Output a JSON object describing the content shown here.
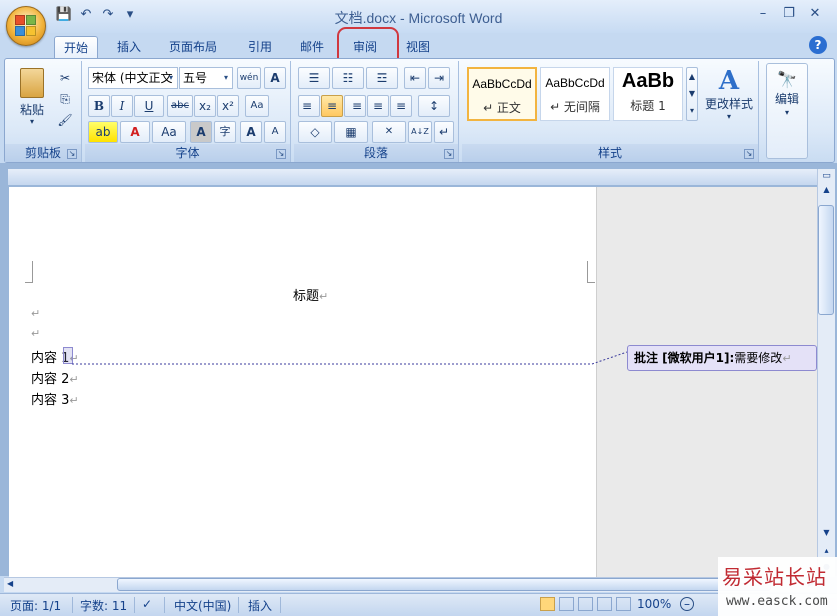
{
  "window": {
    "title": "文档.docx - Microsoft Word"
  },
  "qat": {
    "save": "💾",
    "undo": "↶",
    "redo": "↷",
    "customize": "▾"
  },
  "controls": {
    "minimize": "–",
    "restore": "❐",
    "close": "✕"
  },
  "tabs": [
    {
      "label": "开始",
      "active": true
    },
    {
      "label": "插入"
    },
    {
      "label": "页面布局"
    },
    {
      "label": "引用"
    },
    {
      "label": "邮件"
    },
    {
      "label": "审阅",
      "highlighted": true
    },
    {
      "label": "视图"
    }
  ],
  "help": "?",
  "ribbon": {
    "clipboard": {
      "label": "剪贴板",
      "paste": "粘贴",
      "cut": "✂",
      "copy": "⎘",
      "format_painter": "🖌"
    },
    "font": {
      "label": "字体",
      "font_name": "宋体 (中文正文",
      "font_size": "五号",
      "phonetic": "wén",
      "char_border": "A",
      "bold": "B",
      "italic": "I",
      "underline": "U",
      "strike": "abc",
      "subscript": "x₂",
      "superscript": "x²",
      "clear": "Aa",
      "highlight": "ab",
      "font_color": "A",
      "change_case": "Aa",
      "char_shading": "A",
      "enclose": "字",
      "grow": "A",
      "shrink": "A"
    },
    "paragraph": {
      "label": "段落",
      "bullets": "☰",
      "numbering": "☷",
      "multilevel": "☲",
      "decrease_indent": "⇤",
      "increase_indent": "⇥",
      "align_left": "≡",
      "center": "≡",
      "align_right": "≡",
      "justify": "≡",
      "distributed": "≡",
      "line_spacing": "↕",
      "shading": "◇",
      "borders": "▦",
      "sort": "A↓Z",
      "show_marks": "↵"
    },
    "styles": {
      "label": "样式",
      "items": [
        {
          "sample": "AaBbCcDd",
          "name": "↵ 正文",
          "selected": true
        },
        {
          "sample": "AaBbCcDd",
          "name": "↵ 无间隔"
        },
        {
          "sample": "AaBb",
          "name": "标题 1"
        }
      ],
      "change_styles": "更改样式"
    },
    "editing": {
      "label": "编辑",
      "icon": "🔭"
    }
  },
  "document": {
    "title": "标题",
    "mark": "↵",
    "lines": [
      "内容 1",
      "内容 2",
      "内容 3"
    ]
  },
  "comment": {
    "label": "批注 [微软用户1]:",
    "text": "需要修改"
  },
  "status": {
    "page": "页面: 1/1",
    "words": "字数: 11",
    "language": "中文(中国)",
    "mode": "插入",
    "zoom": "100%"
  },
  "watermark": {
    "line1": "易采站长站",
    "line2": "www.easck.com"
  }
}
